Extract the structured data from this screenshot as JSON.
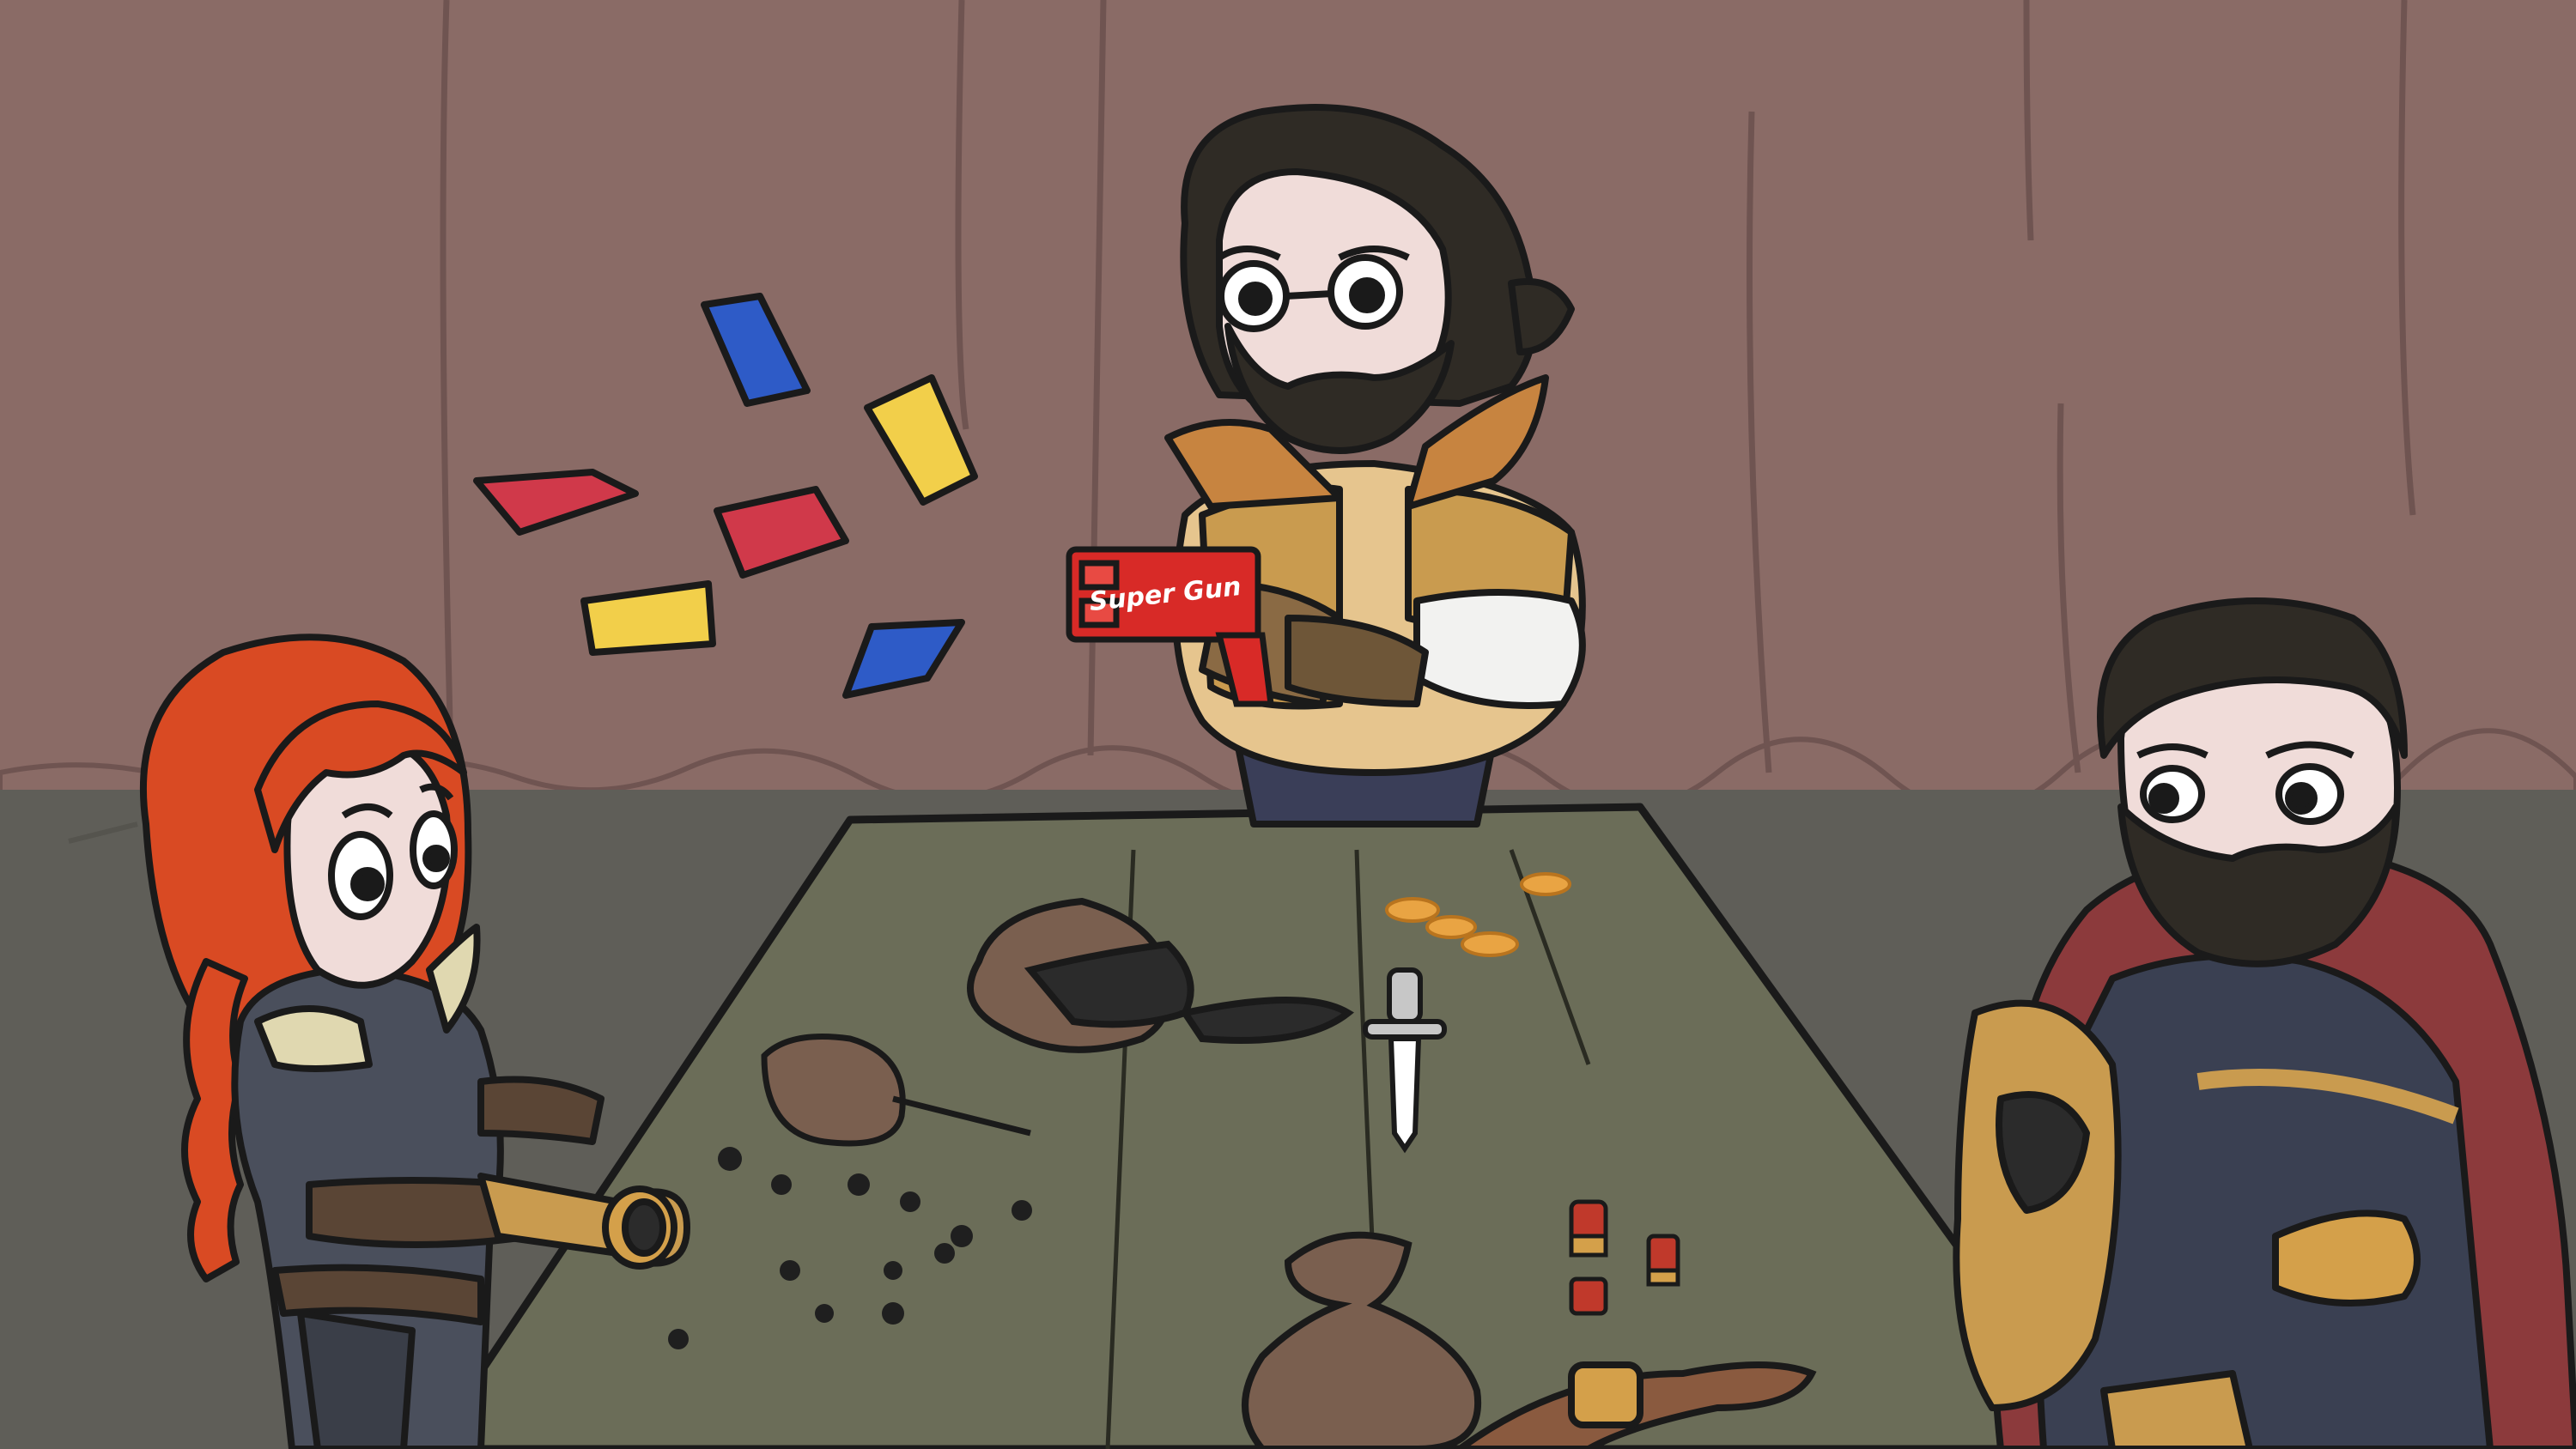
{
  "scene": {
    "gun_label": "Super Gun"
  },
  "colors": {
    "wall": "#8a6b66",
    "floor": "#5f5e58",
    "table": "#6b6d58",
    "outline": "#1a1a1a",
    "hair_red": "#d94a23",
    "hair_dark": "#2f2b25",
    "skin": "#f0dcd9",
    "cape_red": "#8c3a3c",
    "gold": "#c99b4f",
    "gun_red": "#d82a27",
    "confetti_blue": "#2e5bc7",
    "confetti_yellow": "#f2cf4a",
    "confetti_red": "#d0394a",
    "coin": "#e9a443"
  }
}
